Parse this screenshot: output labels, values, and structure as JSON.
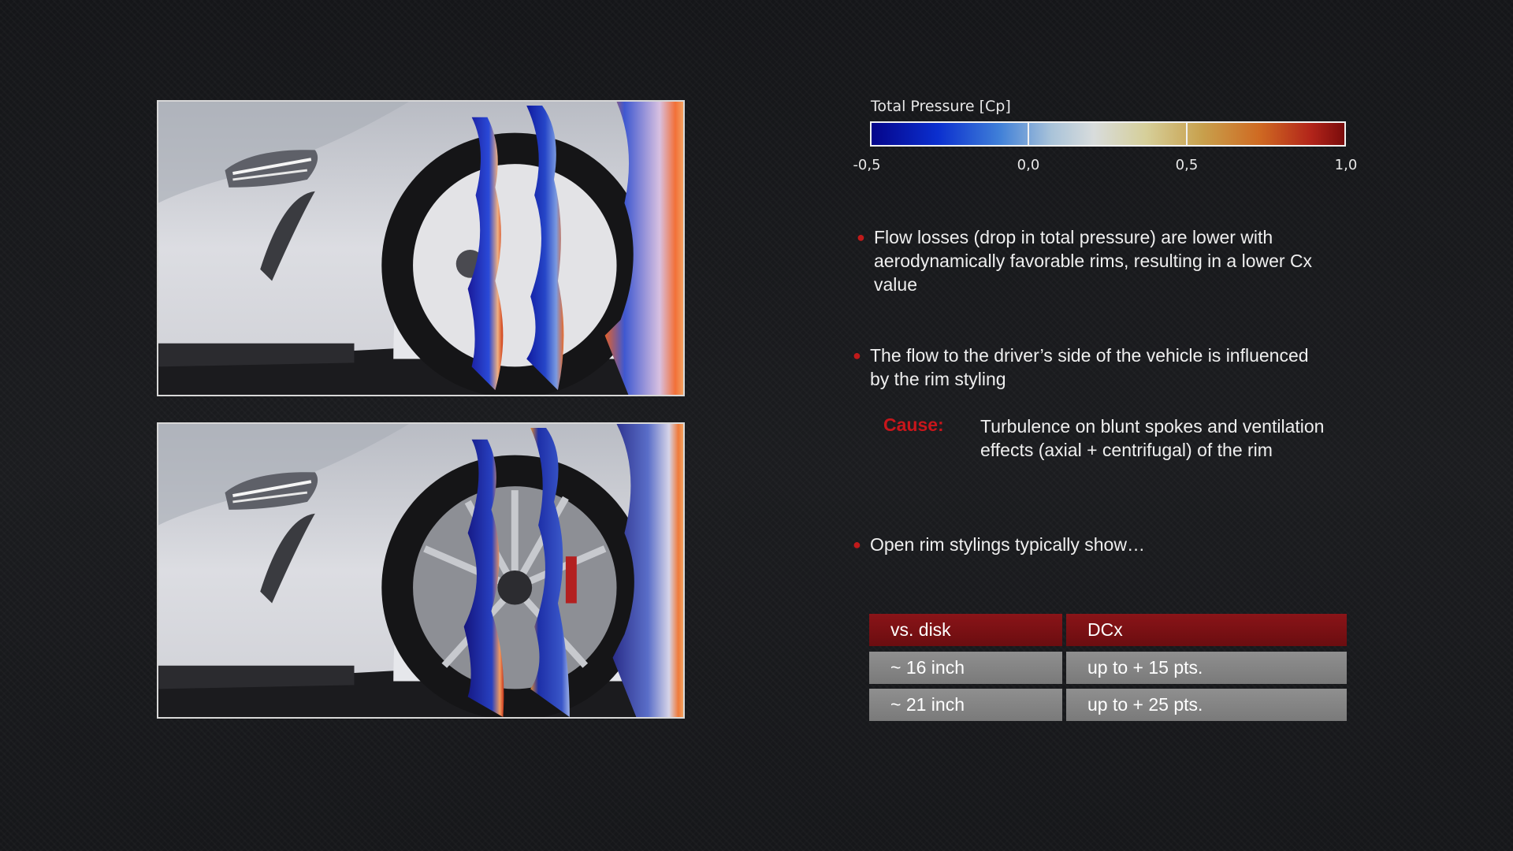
{
  "legend": {
    "title": "Total Pressure [Cp]",
    "ticks": [
      "-0,5",
      "0,0",
      "0,5",
      "1,0"
    ]
  },
  "bullets": [
    "Flow losses (drop in total pressure) are lower with aerodynamically favorable rims, resulting in a lower Cx value",
    "The flow to the driver’s side of the vehicle is influenced by the rim styling",
    "Open rim stylings typically show…"
  ],
  "cause": {
    "label": "Cause:",
    "text": "Turbulence on blunt spokes and ventilation effects (axial + centrifugal) of the rim"
  },
  "table": {
    "header": [
      "vs. disk",
      "DCx"
    ],
    "rows": [
      [
        "~ 16 inch",
        "up to + 15 pts."
      ],
      [
        "~ 21 inch",
        "up to + 25 pts."
      ]
    ]
  },
  "colors": {
    "accent_red": "#c8161b",
    "table_header": "#7a1013",
    "table_row": "#858585"
  },
  "images": {
    "top": "car-front-wheel-disk-rim-pressure-slices",
    "bottom": "car-front-wheel-open-rim-pressure-slices"
  }
}
